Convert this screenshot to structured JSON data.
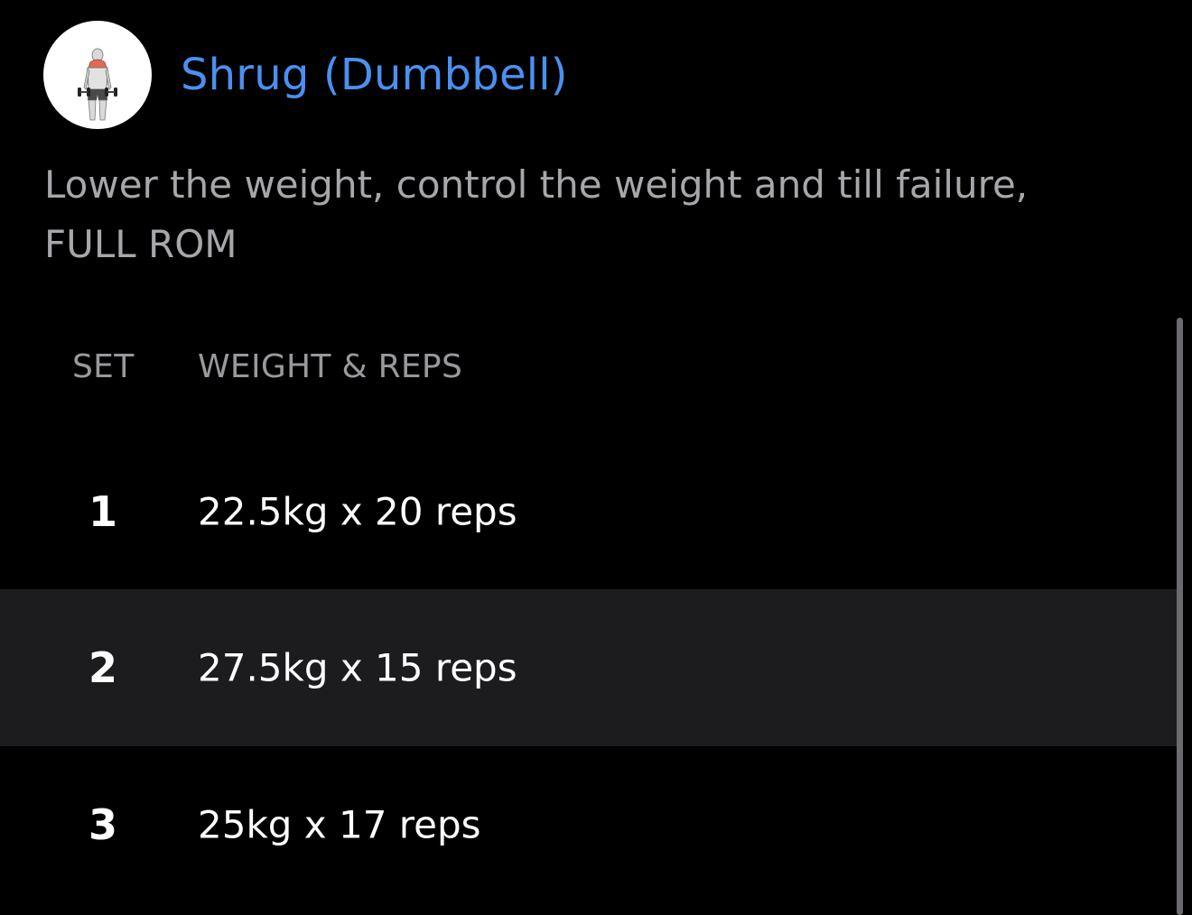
{
  "exercise": {
    "title": "Shrug (Dumbbell)",
    "icon": "shrug-exercise-illustration-icon",
    "notes": "Lower the weight, control the weight and till failure, FULL ROM"
  },
  "table": {
    "headers": {
      "set": "SET",
      "weight_reps": "WEIGHT & REPS"
    },
    "rows": [
      {
        "set": "1",
        "value": "22.5kg x 20 reps"
      },
      {
        "set": "2",
        "value": "27.5kg x 15 reps"
      },
      {
        "set": "3",
        "value": "25kg x 17 reps"
      }
    ]
  },
  "colors": {
    "title": "#4a90f0",
    "background": "#000000",
    "alt_row": "#1c1c1e",
    "muted_text": "#a7a7ab"
  }
}
